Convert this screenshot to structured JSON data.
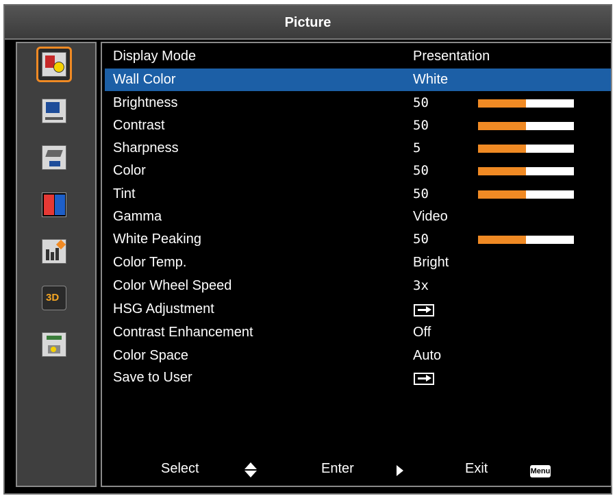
{
  "title": "Picture",
  "sidebar": {
    "items": [
      {
        "icon": "picture-settings-icon",
        "active": true
      },
      {
        "icon": "display-settings-icon",
        "active": false
      },
      {
        "icon": "setup-icon",
        "active": false
      },
      {
        "icon": "color-blocks-icon",
        "active": false
      },
      {
        "icon": "information-icon",
        "active": false
      },
      {
        "icon": "3d-icon",
        "label": "3D",
        "active": false
      },
      {
        "icon": "network-icon",
        "active": false
      }
    ]
  },
  "menu": {
    "rows": [
      {
        "label": "Display Mode",
        "value": "Presentation"
      },
      {
        "label": "Wall Color",
        "value": "White"
      },
      {
        "label": "Brightness",
        "value": "50",
        "level": 0.5
      },
      {
        "label": "Contrast",
        "value": "50",
        "level": 0.5
      },
      {
        "label": "Sharpness",
        "value": "5",
        "level": 0.5
      },
      {
        "label": "Color",
        "value": "50",
        "level": 0.5
      },
      {
        "label": "Tint",
        "value": "50",
        "level": 0.5
      },
      {
        "label": "Gamma",
        "value": "Video"
      },
      {
        "label": "White Peaking",
        "value": "50",
        "level": 0.5
      },
      {
        "label": "Color Temp.",
        "value": "Bright"
      },
      {
        "label": "Color Wheel Speed",
        "value": "3x"
      },
      {
        "label": "HSG Adjustment",
        "value": ""
      },
      {
        "label": "Contrast Enhancement",
        "value": "Off"
      },
      {
        "label": "Color Space",
        "value": "Auto"
      },
      {
        "label": "Save to User",
        "value": ""
      }
    ]
  },
  "footer": {
    "select": "Select",
    "enter": "Enter",
    "exit": "Exit",
    "menu_key": "Menu"
  },
  "colors": {
    "accent": "#f08a24",
    "selection": "#1c5fa6"
  }
}
